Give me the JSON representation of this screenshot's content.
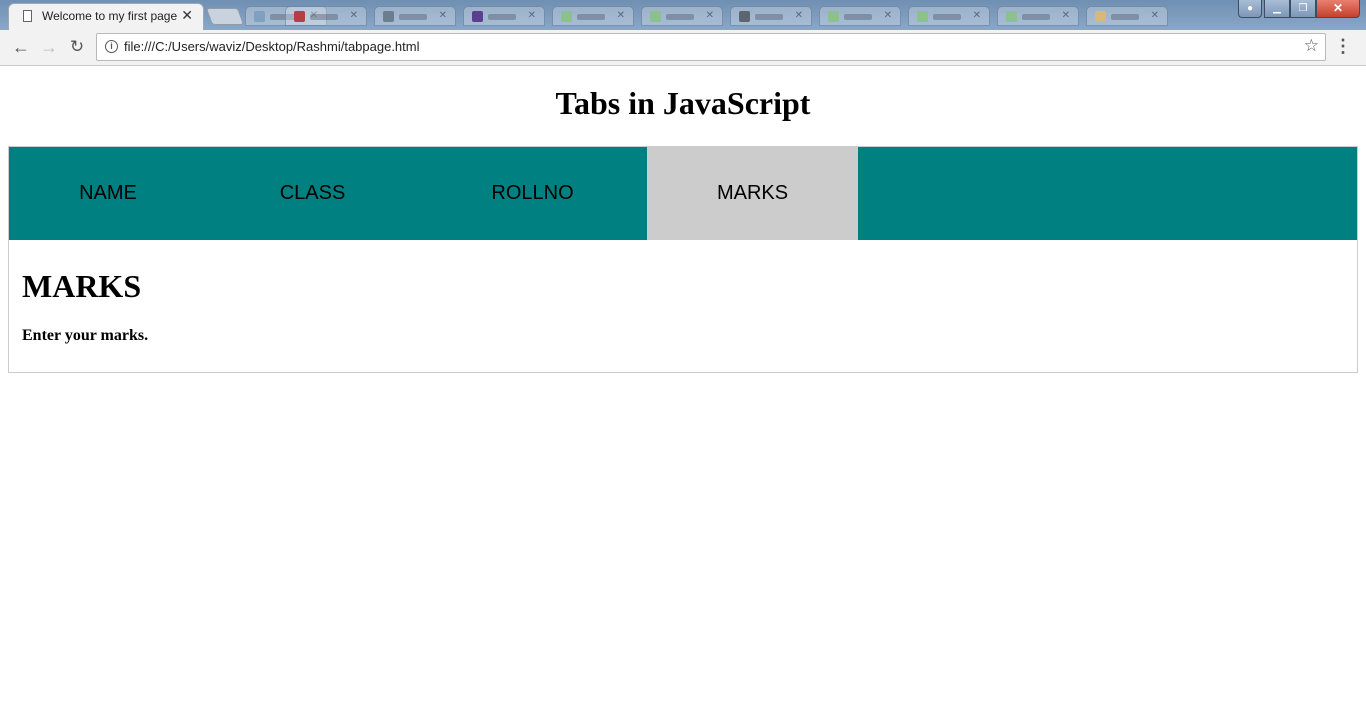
{
  "browser": {
    "active_tab_title": "Welcome to my first page",
    "url": "file:///C:/Users/waviz/Desktop/Rashmi/tabpage.html"
  },
  "page": {
    "title": "Tabs in JavaScript",
    "tabs": [
      {
        "label": "NAME",
        "active": false
      },
      {
        "label": "CLASS",
        "active": false
      },
      {
        "label": "ROLLNO",
        "active": false
      },
      {
        "label": "MARKS",
        "active": true
      }
    ],
    "panel": {
      "heading": "MARKS",
      "text": "Enter your marks."
    }
  },
  "colors": {
    "tab_bar": "#008080",
    "active_tab": "#cccccc"
  }
}
